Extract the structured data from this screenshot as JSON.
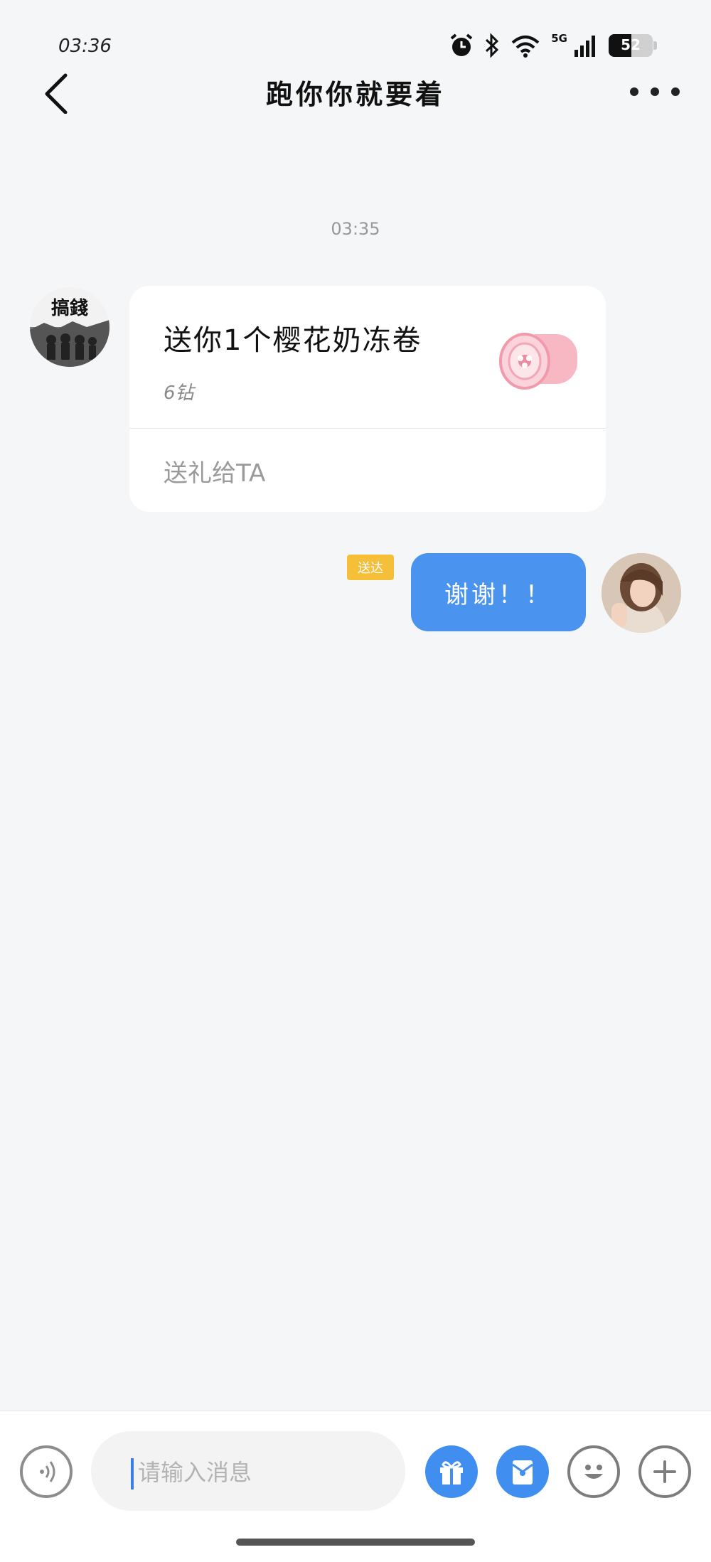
{
  "status_bar": {
    "time": "03:36",
    "network_label": "5G",
    "battery_level": "52",
    "battery_fraction": 0.52
  },
  "header": {
    "title": "跑你你就要着",
    "back_icon": "chevron-left-icon",
    "more_icon": "more-horizontal-icon"
  },
  "messages": {
    "timestamp": "03:35",
    "avatar_left_text": "搞錢",
    "gift_card": {
      "title": "送你1个樱花奶冻卷",
      "price": "6钻",
      "action_label": "送礼给TA"
    },
    "reply": {
      "read_badge": "送达",
      "text": "谢谢！！"
    }
  },
  "input_bar": {
    "placeholder": "请输入消息",
    "icons": [
      "voice-icon",
      "gift-icon",
      "red-packet-icon",
      "emoji-icon",
      "plus-icon"
    ]
  },
  "colors": {
    "accent_blue": "#4a94f0",
    "badge_yellow": "#f5bf3a",
    "background": "#f5f6f8"
  }
}
